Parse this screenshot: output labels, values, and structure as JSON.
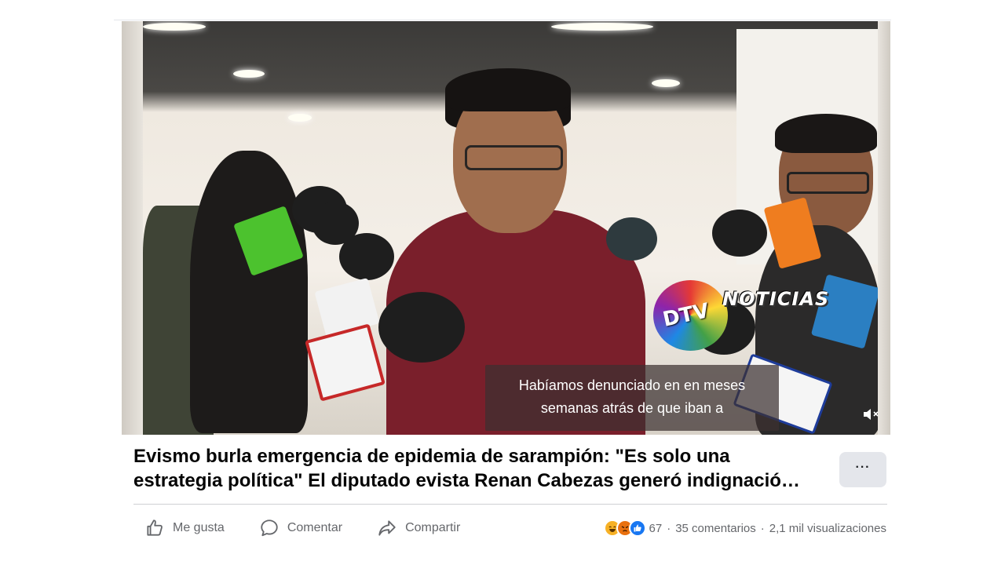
{
  "video": {
    "caption_line1": "Habíamos denunciado en en meses",
    "caption_line2": "semanas atrás de que iban a",
    "watermark_logo": "DTV",
    "watermark_text": "NOTICIAS",
    "mute_icon": "speaker-muted-icon"
  },
  "post": {
    "title_line1": "Evismo burla emergencia de epidemia de sarampión: \"Es solo una",
    "title_line2": "estrategia política\" El diputado evista Renan Cabezas generó indignació…",
    "more_label": "···"
  },
  "actions": {
    "like_label": "Me gusta",
    "comment_label": "Comentar",
    "share_label": "Compartir"
  },
  "stats": {
    "reactions_count": "67",
    "comments": "35 comentarios",
    "views": "2,1 mil visualizaciones",
    "separator": "·"
  },
  "colors": {
    "like_blue": "#1877f2",
    "secondary_text": "#65676b",
    "button_bg": "#e4e6eb"
  }
}
